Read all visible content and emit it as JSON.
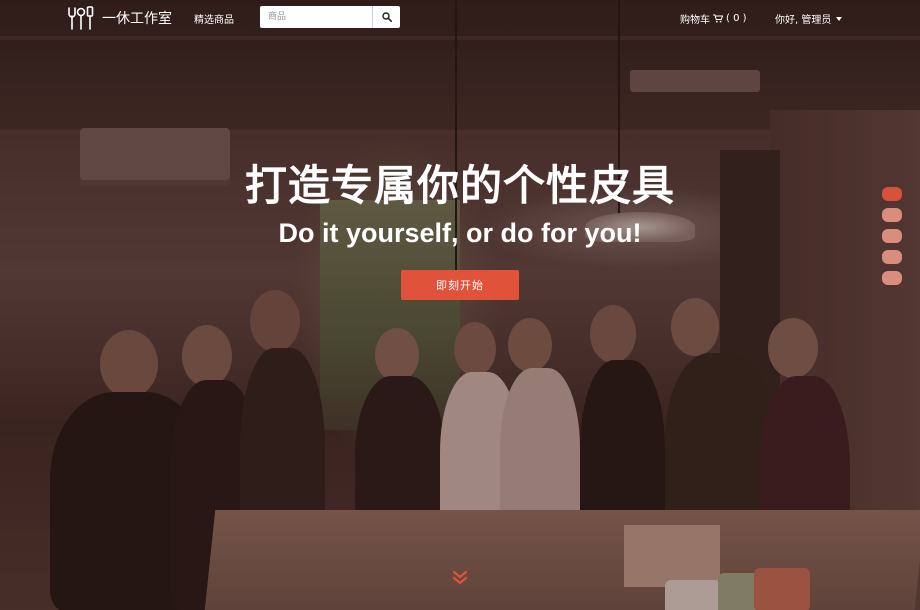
{
  "navbar": {
    "brand_name": "一休工作室",
    "featured_label": "精选商品",
    "search_placeholder": "商品",
    "cart_label": "购物车",
    "cart_count": "( 0 )",
    "user_greeting": "你好, 管理员"
  },
  "hero": {
    "headline": "打造专属你的个性皮具",
    "subhead": "Do it yourself, or do for you!",
    "cta_label": "即刻开始",
    "slide_count": 5,
    "active_slide": 1
  },
  "colors": {
    "accent": "#e0523a",
    "dot_inactive": "#d98e7d",
    "dot_active": "#d6523c"
  },
  "icons": {
    "logo": "tools-logo-icon",
    "search": "search-icon",
    "cart": "cart-icon",
    "dropdown": "caret-down-icon",
    "scroll": "double-chevron-down-icon"
  }
}
